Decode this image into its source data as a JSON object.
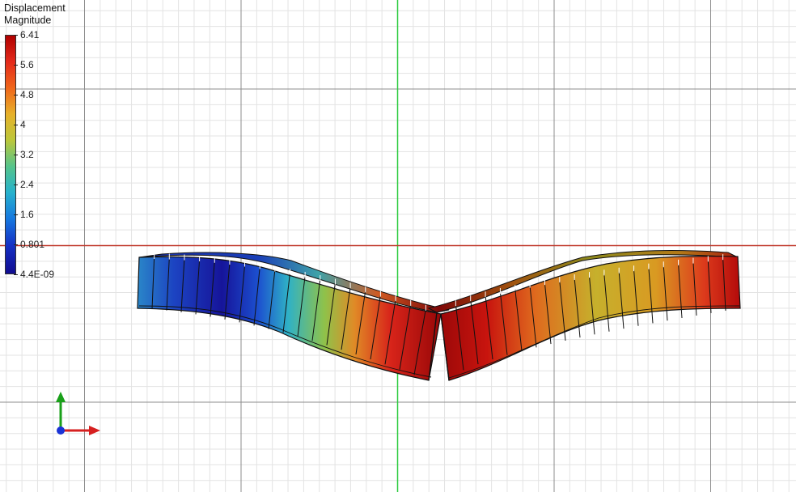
{
  "legend": {
    "title_line1": "Displacement",
    "title_line2": "Magnitude",
    "ticks": [
      "6.41",
      "5.6",
      "4.8",
      "4",
      "3.2",
      "2.4",
      "1.6",
      "0.801",
      "4.4E-09"
    ]
  },
  "colors": {
    "x_axis": "#c0392b",
    "y_axis": "#2ecc40",
    "gizmo_x": "#d62020",
    "gizmo_y": "#1aa01a",
    "gizmo_z": "#1a33d6",
    "grid_major": "#8c8c8c",
    "grid_minor": "#e3e3e3"
  },
  "viewport": {
    "view": "front",
    "deformed_shape": "beam-v-bend"
  }
}
